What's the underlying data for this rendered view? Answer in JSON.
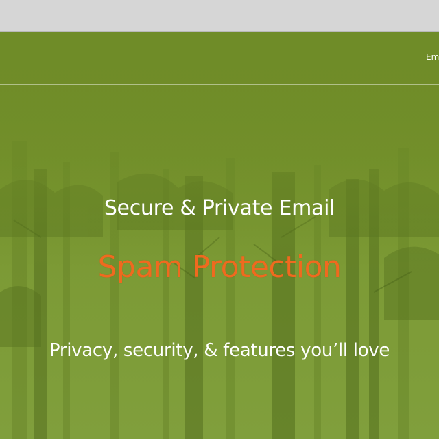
{
  "header": {
    "nav_link_partial": "Email"
  },
  "hero": {
    "title": "Secure & Private Email",
    "rotating_feature": "Spam Protection",
    "subtitle": "Privacy, security, & features you’ll love"
  },
  "colors": {
    "accent_orange": "#ef6a1f",
    "hero_green": "#76932d",
    "browser_chrome": "#d6d6d6"
  }
}
